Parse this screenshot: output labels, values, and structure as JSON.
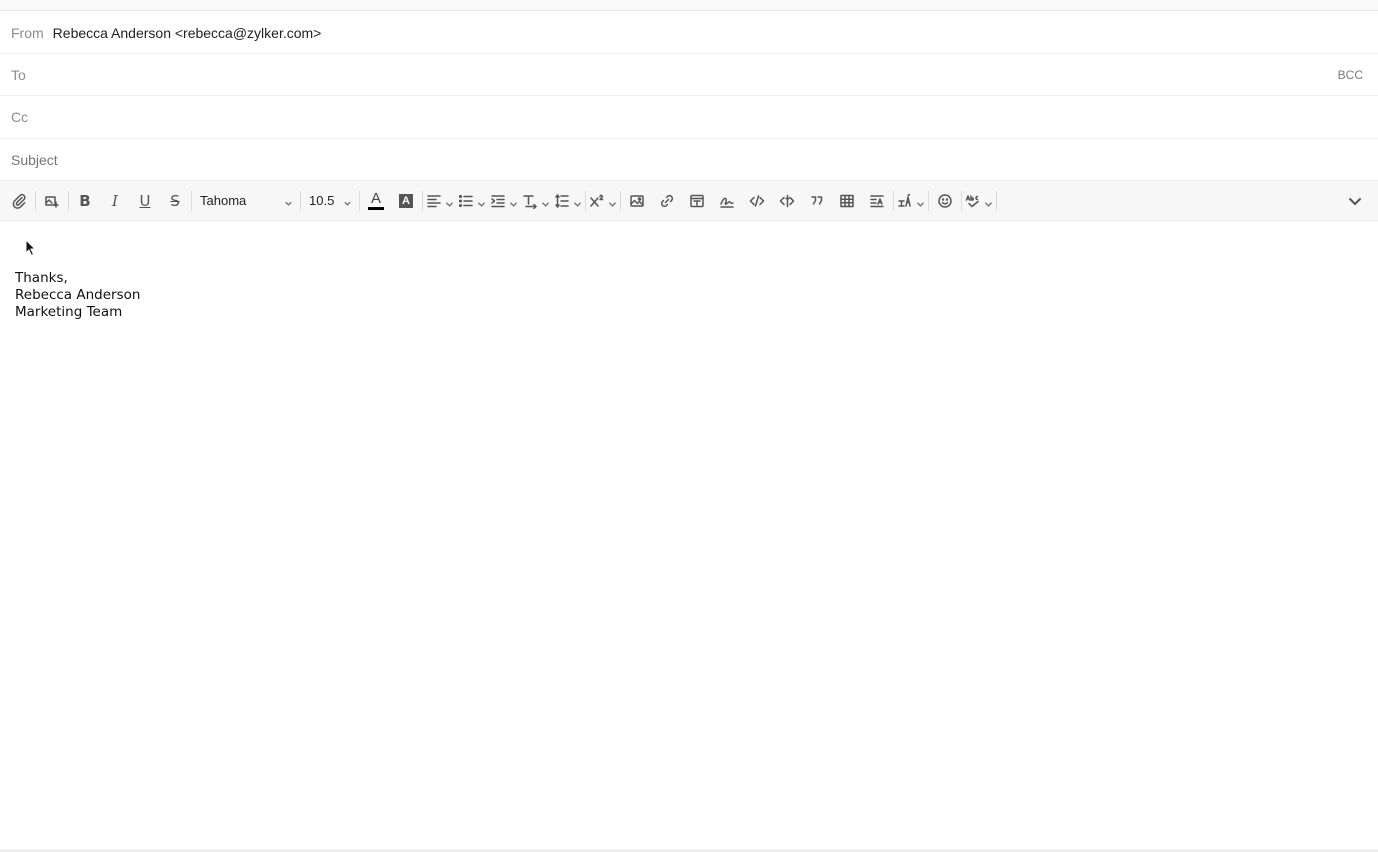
{
  "compose": {
    "from_label": "From",
    "from_value": "Rebecca Anderson <rebecca@zylker.com>",
    "to_label": "To",
    "to_value": "",
    "bcc_label": "BCC",
    "cc_label": "Cc",
    "cc_value": "",
    "subject_placeholder": "Subject",
    "subject_value": ""
  },
  "toolbar": {
    "font_family": "Tahoma",
    "font_size": "10.5",
    "font_color": "#000000",
    "icons": [
      "attach-icon",
      "insert-from-cloud-icon",
      "bold-icon",
      "italic-icon",
      "underline-icon",
      "strikethrough-icon",
      "font-color-icon",
      "highlight-icon",
      "align-icon",
      "list-icon",
      "indent-icon",
      "text-direction-icon",
      "line-height-icon",
      "superscript-icon",
      "insert-image-icon",
      "insert-link-icon",
      "template-icon",
      "signature-icon",
      "code-icon",
      "html-icon",
      "quote-icon",
      "table-icon",
      "paragraph-format-icon",
      "clear-format-icon",
      "emoji-icon",
      "spellcheck-icon",
      "collapse-toolbar-icon"
    ]
  },
  "body": {
    "signature_lines": [
      "Thanks,",
      "Rebecca Anderson",
      "Marketing Team"
    ]
  }
}
